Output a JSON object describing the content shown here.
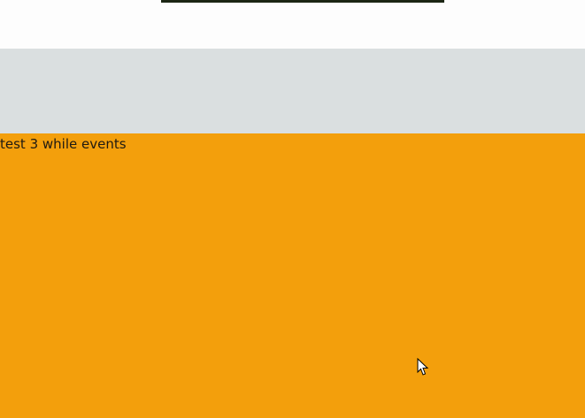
{
  "sections": {
    "orange": {
      "text": "test 3 while events",
      "background": "#f39f0c"
    },
    "gray_band": {
      "background": "#dadfe0"
    },
    "media_strip": {
      "color": "#1c2614"
    }
  },
  "cursor": {
    "icon": "mouse-pointer-icon"
  }
}
